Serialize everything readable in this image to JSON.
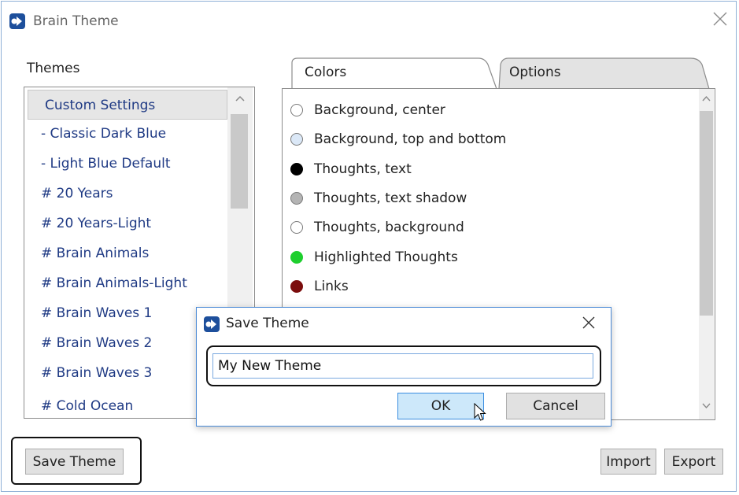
{
  "window": {
    "title": "Brain Theme"
  },
  "themes": {
    "label": "Themes",
    "items": [
      "Custom Settings",
      "- Classic Dark Blue",
      "- Light Blue Default",
      "# 20 Years",
      "# 20 Years-Light",
      "# Brain Animals",
      "# Brain Animals-Light",
      "# Brain Waves 1",
      "# Brain Waves 2",
      "# Brain Waves 3",
      "# Cold Ocean"
    ],
    "selected": "Custom Settings"
  },
  "tabs": {
    "colors": "Colors",
    "options": "Options"
  },
  "colors": [
    {
      "label": "Background, center",
      "color": "#ffffff"
    },
    {
      "label": "Background, top and bottom",
      "color": "#dbe8f7"
    },
    {
      "label": "Thoughts, text",
      "color": "#000000"
    },
    {
      "label": "Thoughts, text shadow",
      "color": "#b4b4b4"
    },
    {
      "label": "Thoughts, background",
      "color": "#ffffff"
    },
    {
      "label": "Highlighted Thoughts",
      "color": "#1ecf2e"
    },
    {
      "label": "Links",
      "color": "#7b0d0d"
    }
  ],
  "buttons": {
    "save_theme": "Save Theme",
    "import": "Import",
    "export": "Export"
  },
  "dialog": {
    "title": "Save Theme",
    "input_value": "My New Theme",
    "ok": "OK",
    "cancel": "Cancel"
  }
}
